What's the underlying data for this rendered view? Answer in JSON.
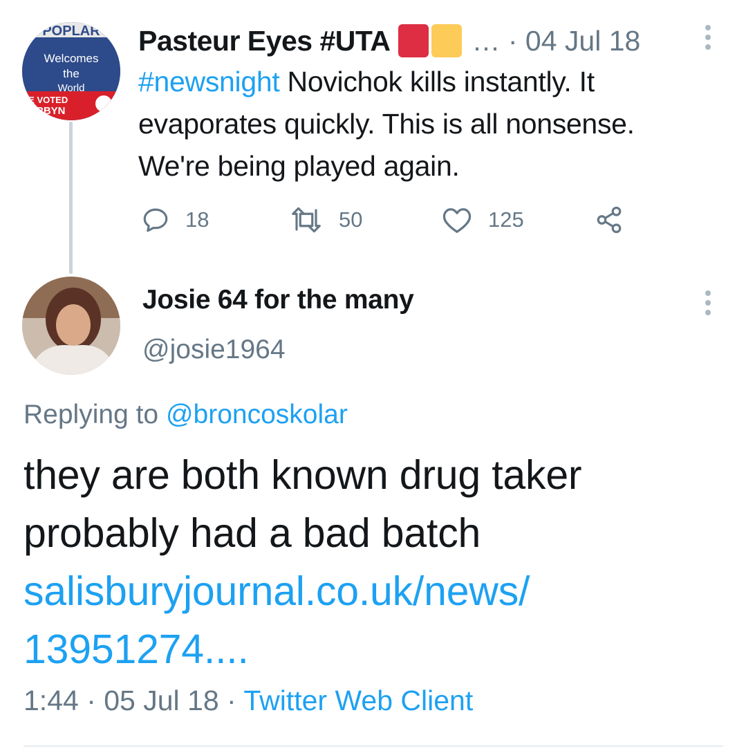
{
  "parent_tweet": {
    "avatar": {
      "lines": [
        "POPLAR",
        "Welcomes",
        "the",
        "World",
        "I'VE VOTED",
        "CORBYN"
      ]
    },
    "author_name": "Pasteur Eyes #UTA",
    "meta": "… · 04 Jul 18",
    "hashtag": "#newsnight",
    "text": " Novichok kills instantly. It evaporates quickly. This is all nonsense. We're being played again.",
    "replies": "18",
    "retweets": "50",
    "likes": "125"
  },
  "reply_tweet": {
    "author_name": "Josie 64 for the many",
    "handle": "@josie1964",
    "replying_label": "Replying to ",
    "replying_handle": "@broncoskolar",
    "body_text": "they are both known drug taker probably had a bad batch",
    "link_text": "salisburyjournal.co.uk/news/ 13951274....",
    "time_date": "1:44 · 05 Jul 18 · ",
    "client": "Twitter Web Client"
  },
  "colors": {
    "accent": "#1da1f2",
    "muted": "#657786",
    "text": "#14171a",
    "flag_red": "#dd2e44",
    "flag_yellow": "#fdcb58"
  },
  "icons": [
    "reply-icon",
    "retweet-icon",
    "like-icon",
    "share-icon",
    "more-icon"
  ]
}
